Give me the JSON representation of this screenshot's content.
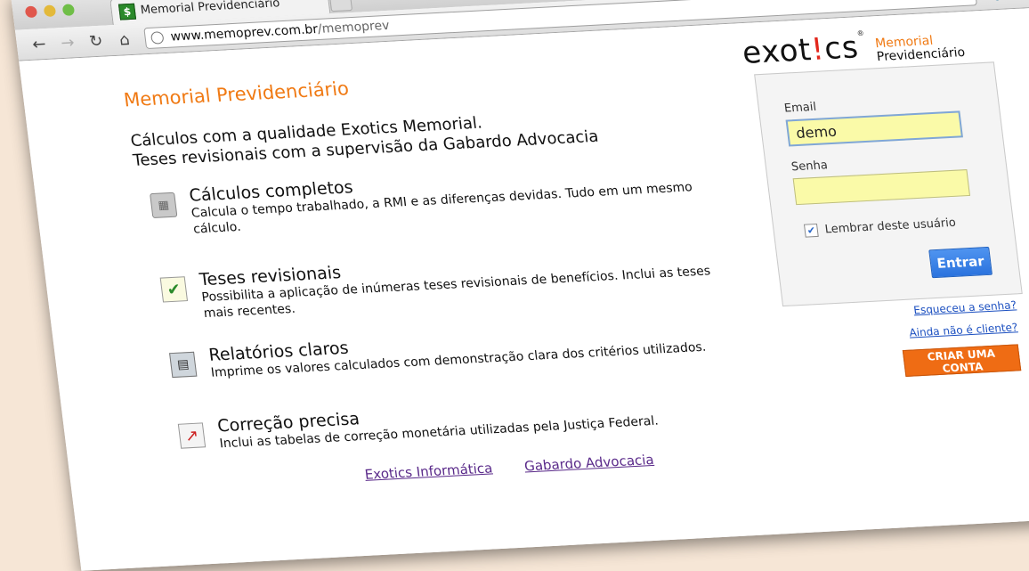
{
  "browser": {
    "tab_title": "Memorial Previdenciário",
    "url_host": "www.memoprev.com.br",
    "url_path": "/memoprev"
  },
  "page": {
    "title": "Memorial Previdenciário",
    "intro_line1": "Cálculos com a qualidade Exotics Memorial.",
    "intro_line2": "Teses revisionais com a supervisão da Gabardo Advocacia",
    "features": [
      {
        "title": "Cálculos completos",
        "desc": "Calcula o tempo trabalhado, a RMI e as diferenças devidas. Tudo em um mesmo cálculo."
      },
      {
        "title": "Teses revisionais",
        "desc": "Possibilita a aplicação de inúmeras teses revisionais de benefícios. Inclui as teses mais recentes."
      },
      {
        "title": "Relatórios claros",
        "desc": "Imprime os valores calculados com demonstração clara dos critérios utilizados."
      },
      {
        "title": "Correção precisa",
        "desc": "Inclui as tabelas de correção monetária utilizadas pela Justiça Federal."
      }
    ],
    "footer_links": [
      "Exotics Informática",
      "Gabardo Advocacia"
    ]
  },
  "logo": {
    "brand_a": "exot",
    "brand_bang": "!",
    "brand_b": "cs",
    "reg": "®",
    "sub1": "Memorial",
    "sub2": "Previdenciário"
  },
  "login": {
    "email_label": "Email",
    "email_value": "demo",
    "senha_label": "Senha",
    "senha_value": "",
    "remember_label": "Lembrar deste usuário",
    "remember_checked": true,
    "submit_label": "Entrar"
  },
  "links": {
    "forgot": "Esqueceu a senha?",
    "not_client": "Ainda não é cliente?",
    "create_account": "CRIAR UMA CONTA"
  },
  "icons": {
    "back": "back-arrow-icon",
    "forward": "forward-arrow-icon",
    "reload": "reload-icon",
    "home": "home-icon",
    "star": "star-icon",
    "wrench": "wrench-icon"
  },
  "colors": {
    "accent_orange": "#f07a14",
    "button_blue": "#2b73de",
    "field_yellow": "#fafaa8",
    "link_blue": "#1b4fc0",
    "logo_red": "#e2261c"
  }
}
